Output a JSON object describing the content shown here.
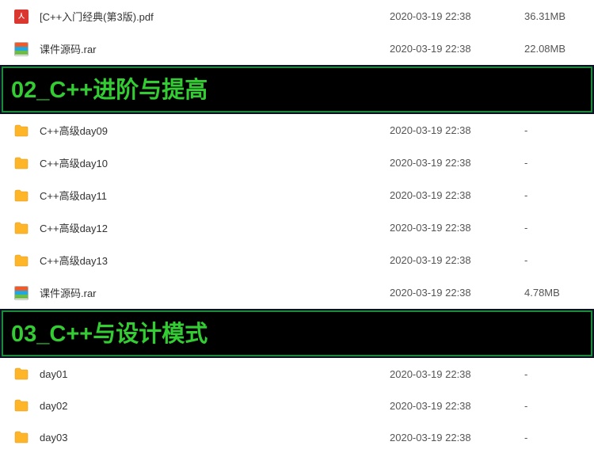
{
  "section0": {
    "rows": [
      {
        "icon": "pdf",
        "name": "[C++入门经典(第3版).pdf",
        "date": "2020-03-19 22:38",
        "size": "36.31MB"
      },
      {
        "icon": "rar",
        "name": "课件源码.rar",
        "date": "2020-03-19 22:38",
        "size": "22.08MB"
      }
    ]
  },
  "section1": {
    "title": "02_C++进阶与提高",
    "rows": [
      {
        "icon": "folder",
        "name": "C++高级day09",
        "date": "2020-03-19 22:38",
        "size": "-"
      },
      {
        "icon": "folder",
        "name": "C++高级day10",
        "date": "2020-03-19 22:38",
        "size": "-"
      },
      {
        "icon": "folder",
        "name": "C++高级day11",
        "date": "2020-03-19 22:38",
        "size": "-"
      },
      {
        "icon": "folder",
        "name": "C++高级day12",
        "date": "2020-03-19 22:38",
        "size": "-"
      },
      {
        "icon": "folder",
        "name": "C++高级day13",
        "date": "2020-03-19 22:38",
        "size": "-"
      },
      {
        "icon": "rar",
        "name": "课件源码.rar",
        "date": "2020-03-19 22:38",
        "size": "4.78MB"
      }
    ]
  },
  "section2": {
    "title": "03_C++与设计模式",
    "rows": [
      {
        "icon": "folder",
        "name": "day01",
        "date": "2020-03-19 22:38",
        "size": "-"
      },
      {
        "icon": "folder",
        "name": "day02",
        "date": "2020-03-19 22:38",
        "size": "-"
      },
      {
        "icon": "folder",
        "name": "day03",
        "date": "2020-03-19 22:38",
        "size": "-"
      }
    ]
  }
}
